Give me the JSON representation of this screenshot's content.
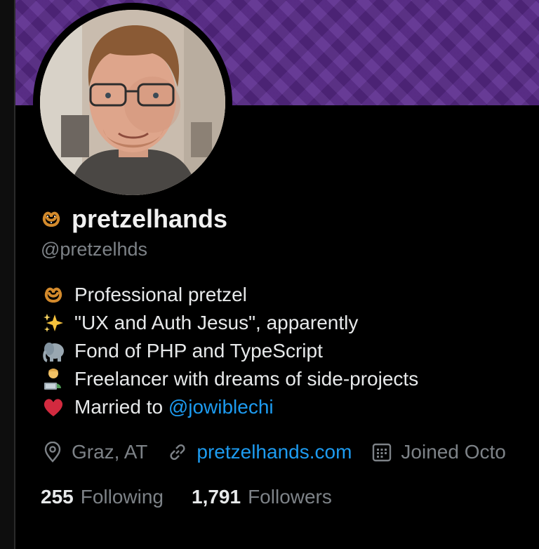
{
  "profile": {
    "display_name": "pretzelhands",
    "handle": "@pretzelhds",
    "name_emoji": "pretzel-icon"
  },
  "bio": {
    "lines": [
      {
        "emoji": "pretzel-icon",
        "text": "Professional pretzel"
      },
      {
        "emoji": "sparkles-icon",
        "text": "\"UX and Auth Jesus\", apparently"
      },
      {
        "emoji": "elephant-icon",
        "text": "Fond of PHP and TypeScript"
      },
      {
        "emoji": "technologist-icon",
        "text": "Freelancer with dreams of side-projects"
      },
      {
        "emoji": "heart-icon",
        "text": "Married to ",
        "mention": "@jowiblechi"
      }
    ]
  },
  "meta": {
    "location": "Graz, AT",
    "website": "pretzelhands.com",
    "joined": "Joined Octo"
  },
  "stats": {
    "following_count": "255",
    "following_label": "Following",
    "followers_count": "1,791",
    "followers_label": "Followers"
  },
  "colors": {
    "banner": "#5a2a8c",
    "link": "#1d9bf0",
    "muted": "#7d8287",
    "text": "#e7e9ea",
    "background": "#000000"
  }
}
